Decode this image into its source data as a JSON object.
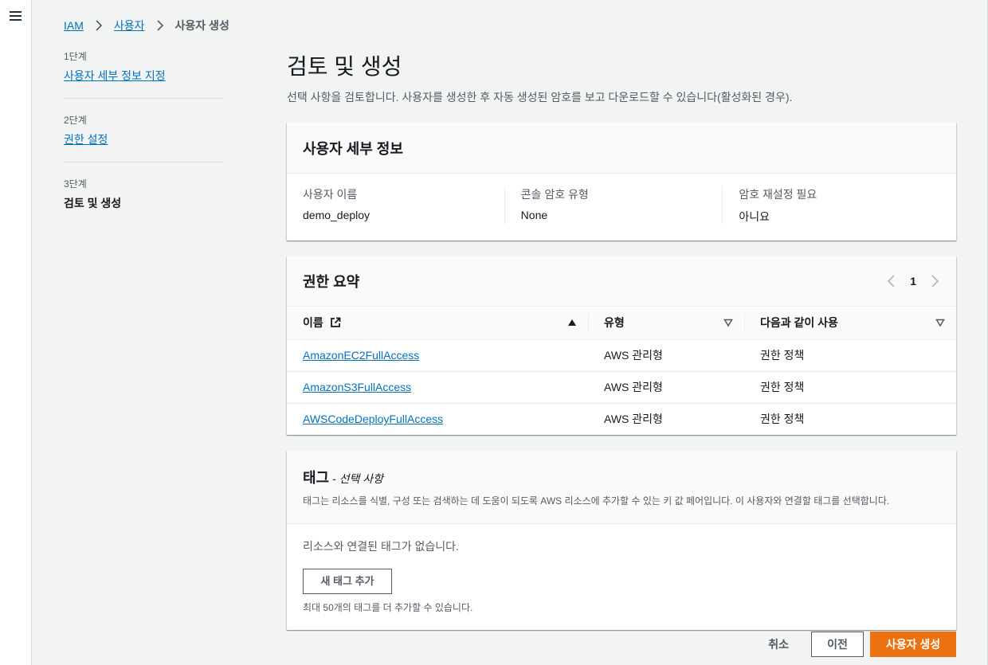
{
  "breadcrumb": {
    "iam": "IAM",
    "users": "사용자",
    "current": "사용자 생성"
  },
  "steps": [
    {
      "num": "1단계",
      "label": "사용자 세부 정보 지정"
    },
    {
      "num": "2단계",
      "label": "권한 설정"
    },
    {
      "num": "3단계",
      "label": "검토 및 생성"
    }
  ],
  "page": {
    "title": "검토 및 생성",
    "description": "선택 사항을 검토합니다. 사용자를 생성한 후 자동 생성된 암호를 보고 다운로드할 수 있습니다(활성화된 경우)."
  },
  "user_details": {
    "title": "사용자 세부 정보",
    "fields": [
      {
        "label": "사용자 이름",
        "value": "demo_deploy"
      },
      {
        "label": "콘솔 암호 유형",
        "value": "None"
      },
      {
        "label": "암호 재설정 필요",
        "value": "아니요"
      }
    ]
  },
  "permissions": {
    "title": "권한 요약",
    "page": "1",
    "headers": {
      "name": "이름",
      "type": "유형",
      "used_as": "다음과 같이 사용"
    },
    "rows": [
      {
        "name": "AmazonEC2FullAccess",
        "type": "AWS 관리형",
        "used_as": "권한 정책"
      },
      {
        "name": "AmazonS3FullAccess",
        "type": "AWS 관리형",
        "used_as": "권한 정책"
      },
      {
        "name": "AWSCodeDeployFullAccess",
        "type": "AWS 관리형",
        "used_as": "권한 정책"
      }
    ]
  },
  "tags": {
    "title": "태그",
    "optional": " - 선택 사항",
    "description": "태그는 리소스를 식별, 구성 또는 검색하는 데 도움이 되도록 AWS 리소스에 추가할 수 있는 키 값 페어입니다. 이 사용자와 연결할 태그를 선택합니다.",
    "none": "리소스와 연결된 태그가 없습니다.",
    "add_button": "새 태그 추가",
    "hint": "최대 50개의 태그를 더 추가할 수 있습니다."
  },
  "footer": {
    "cancel": "취소",
    "previous": "이전",
    "create": "사용자 생성"
  },
  "colors": {
    "accent": "#ec7211",
    "link": "#0073bb"
  }
}
